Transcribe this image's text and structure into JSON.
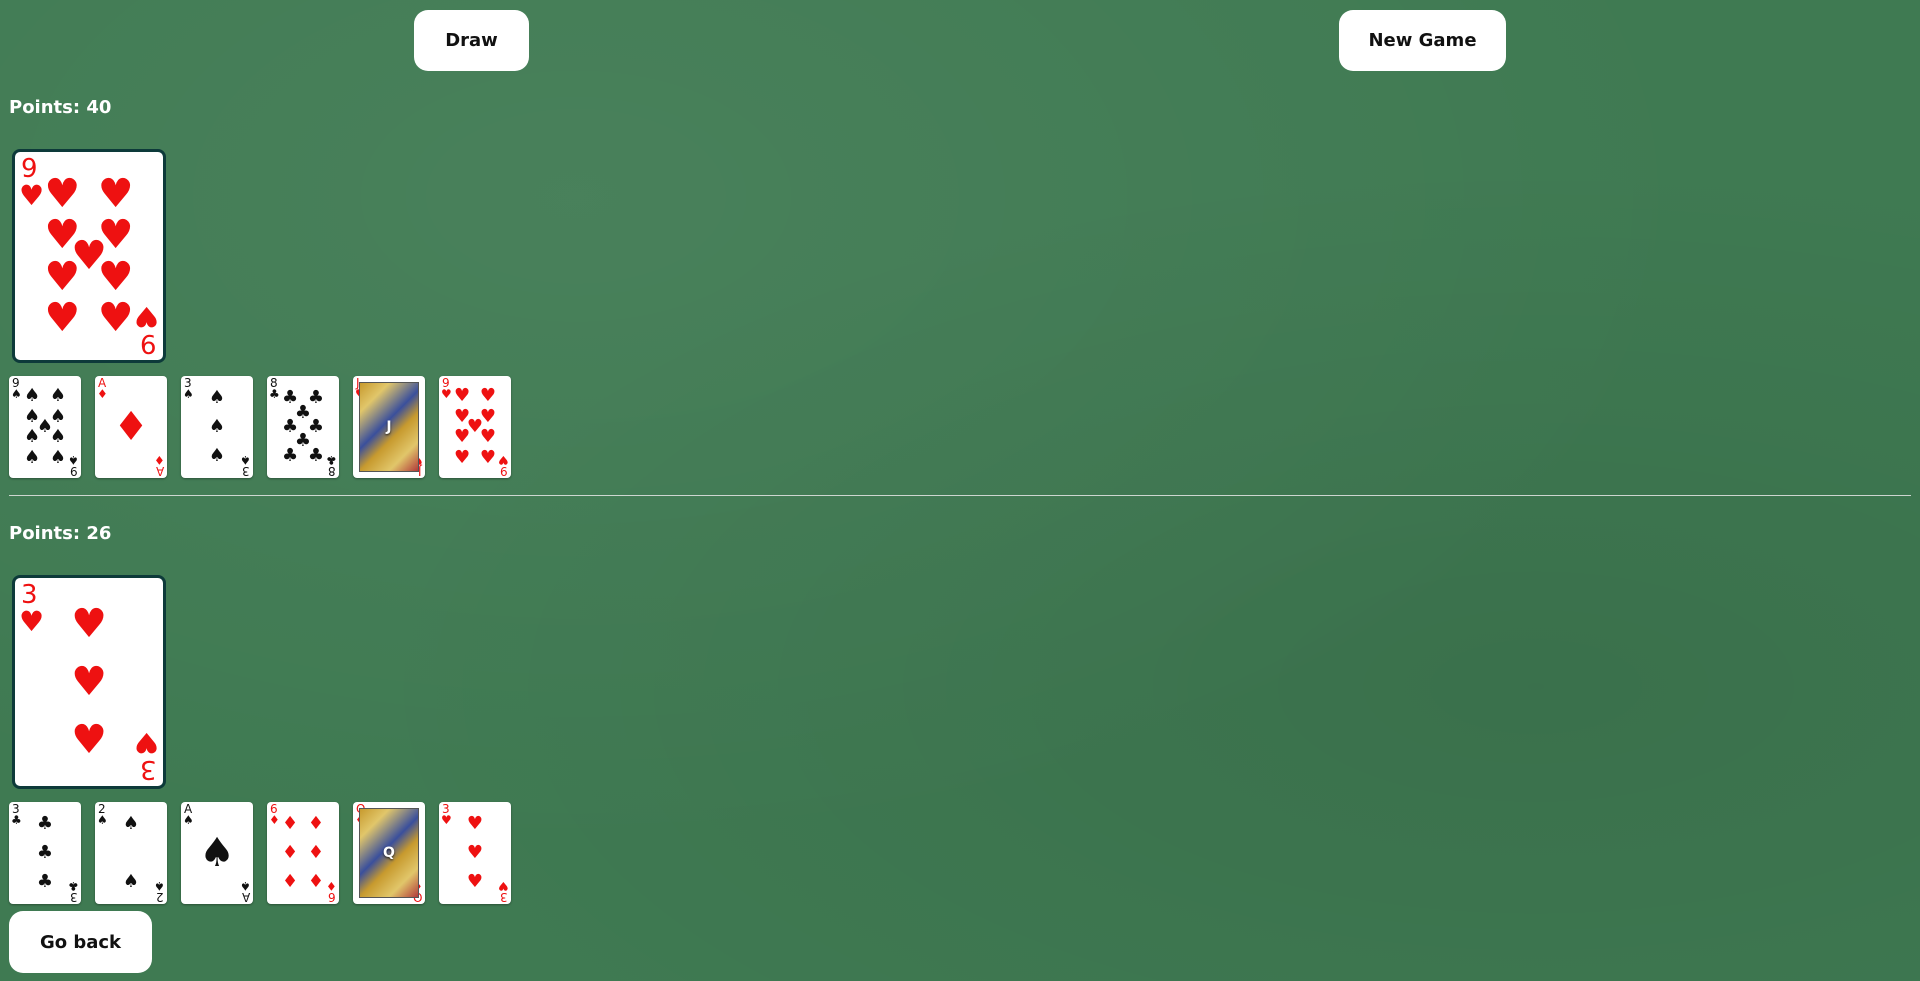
{
  "buttons": {
    "draw": "Draw",
    "new_game": "New Game",
    "go_back": "Go back"
  },
  "player_top": {
    "points_label": "Points: 40",
    "big_card": {
      "rank": "9",
      "suit": "♥",
      "color": "red",
      "pips": 9
    },
    "hand": [
      {
        "rank": "9",
        "suit": "♠",
        "color": "black"
      },
      {
        "rank": "A",
        "suit": "♦",
        "color": "red"
      },
      {
        "rank": "3",
        "suit": "♠",
        "color": "black"
      },
      {
        "rank": "8",
        "suit": "♣",
        "color": "black"
      },
      {
        "rank": "J",
        "suit": "♥",
        "color": "red"
      },
      {
        "rank": "9",
        "suit": "♥",
        "color": "red"
      }
    ]
  },
  "player_bottom": {
    "points_label": "Points: 26",
    "big_card": {
      "rank": "3",
      "suit": "♥",
      "color": "red",
      "pips": 3
    },
    "hand": [
      {
        "rank": "3",
        "suit": "♣",
        "color": "black"
      },
      {
        "rank": "2",
        "suit": "♠",
        "color": "black"
      },
      {
        "rank": "A",
        "suit": "♠",
        "color": "black"
      },
      {
        "rank": "6",
        "suit": "♦",
        "color": "red"
      },
      {
        "rank": "Q",
        "suit": "♦",
        "color": "red"
      },
      {
        "rank": "3",
        "suit": "♥",
        "color": "red"
      }
    ]
  }
}
